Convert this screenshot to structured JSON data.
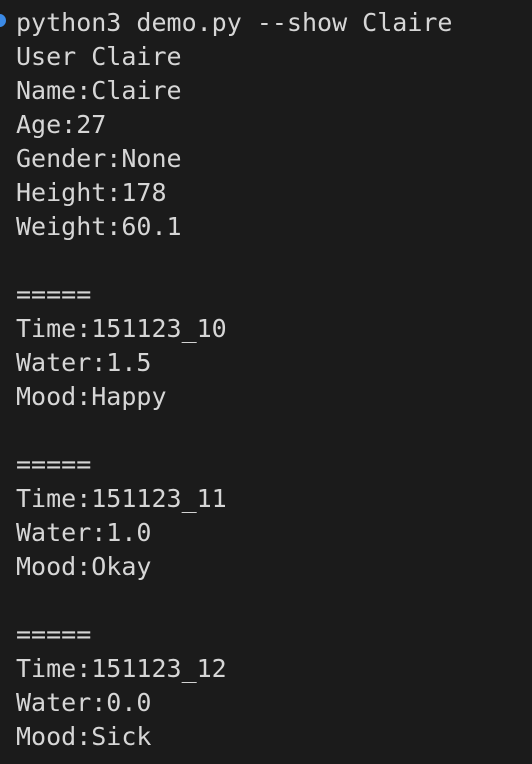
{
  "terminal": {
    "command": "python3 demo.py --show Claire",
    "header": "User Claire",
    "profile": [
      "Name:Claire",
      "Age:27",
      "Gender:None",
      "Height:178",
      "Weight:60.1"
    ],
    "records": [
      {
        "separator": "=====",
        "time": "Time:151123_10",
        "water": "Water:1.5",
        "mood": "Mood:Happy"
      },
      {
        "separator": "=====",
        "time": "Time:151123_11",
        "water": "Water:1.0",
        "mood": "Mood:Okay"
      },
      {
        "separator": "=====",
        "time": "Time:151123_12",
        "water": "Water:0.0",
        "mood": "Mood:Sick"
      }
    ],
    "colors": {
      "background": "#1b1b1b",
      "text": "#d6d6d6",
      "prompt_marker": "#3b8ae6"
    }
  }
}
